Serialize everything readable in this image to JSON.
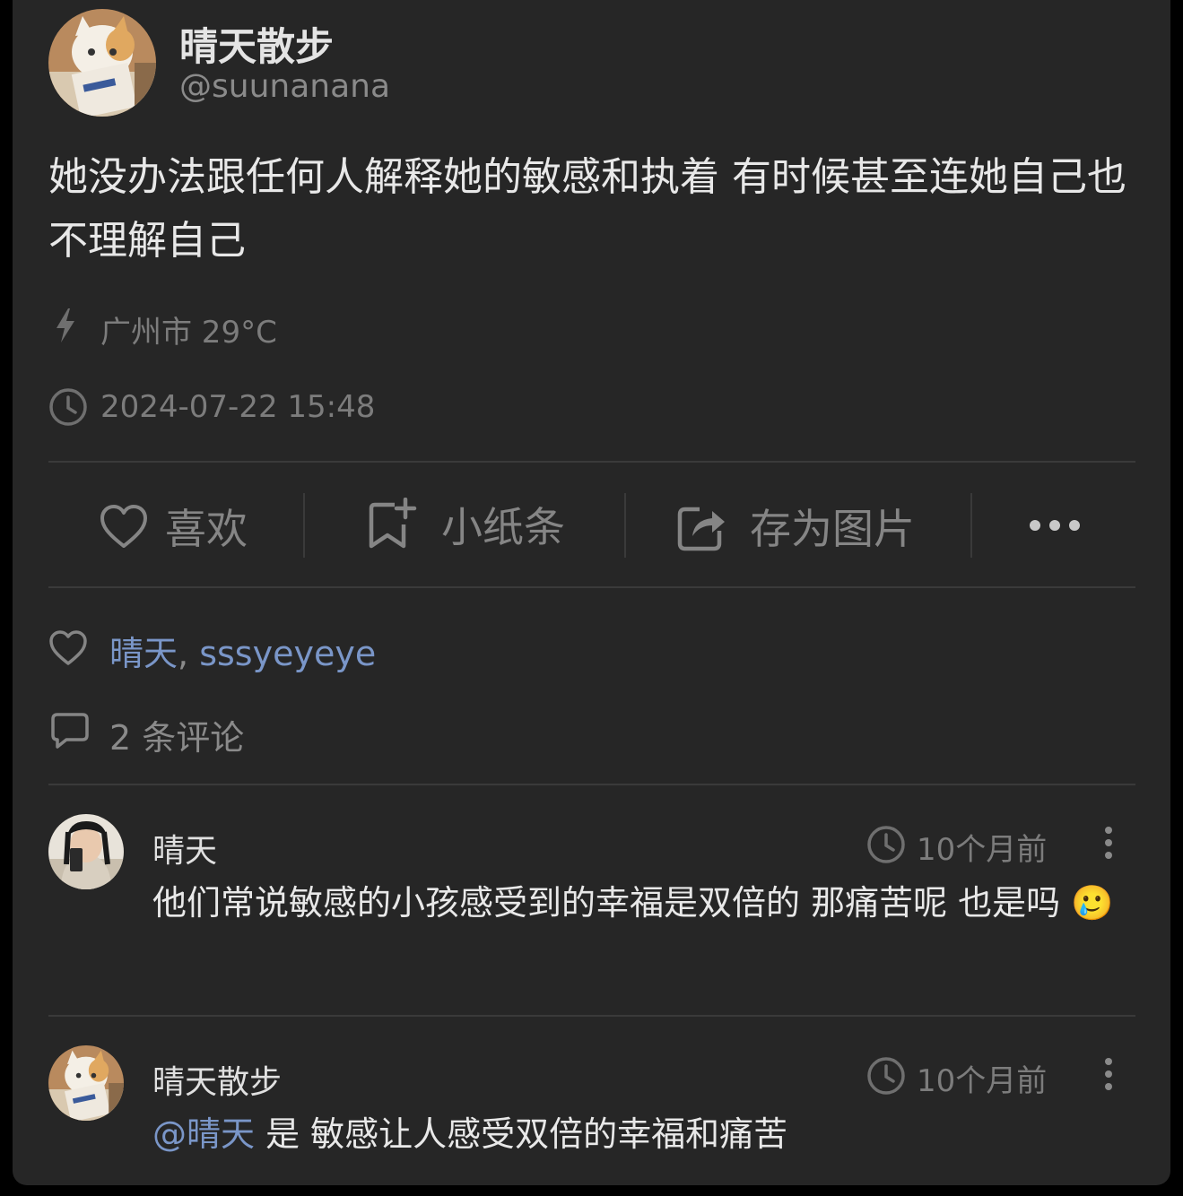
{
  "post": {
    "author_name": "晴天散步",
    "author_handle": "@suunanana",
    "content": "她没办法跟任何人解释她的敏感和执着 有时候甚至连她自己也不理解自己",
    "location": "广州市 29°C",
    "datetime": "2024-07-22 15:48"
  },
  "actions": {
    "like_label": "喜欢",
    "note_label": "小纸条",
    "save_label": "存为图片"
  },
  "likes": {
    "users": [
      "晴天",
      "sssyeyeye"
    ],
    "separator": ","
  },
  "comments_summary": {
    "count_label": "2 条评论"
  },
  "comments": [
    {
      "author": "晴天",
      "time": "10个月前",
      "text": "他们常说敏感的小孩感受到的幸福是双倍的 那痛苦呢 也是吗",
      "emoji": "🥲"
    },
    {
      "author": "晴天散步",
      "time": "10个月前",
      "mention": "@晴天",
      "text": " 是 敏感让人感受双倍的幸福和痛苦"
    }
  ],
  "colors": {
    "background": "#262626",
    "link": "#7a96c8",
    "muted": "#858585"
  },
  "icons": {
    "location": "bolt-icon",
    "time": "clock-icon",
    "like": "heart-icon",
    "note": "bookmark-plus-icon",
    "save": "share-box-icon",
    "more": "more-horizontal-icon",
    "comment": "comment-bubble-icon",
    "comment_more": "more-vertical-icon"
  }
}
